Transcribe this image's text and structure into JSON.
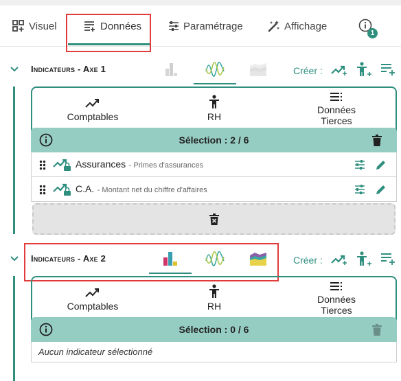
{
  "tabs": [
    {
      "label": "Visuel",
      "icon": "dashboard-add-icon"
    },
    {
      "label": "Données",
      "icon": "list-add-icon",
      "active": true
    },
    {
      "label": "Paramétrage",
      "icon": "sliders-icon"
    },
    {
      "label": "Affichage",
      "icon": "magic-wand-icon"
    }
  ],
  "info_badge": "1",
  "axes": [
    {
      "title_prefix": "Indicateurs - Axe",
      "number": "1",
      "creer_label": "Créer :",
      "categories": [
        "Comptables",
        "RH",
        "Données Tierces"
      ],
      "categories_lines": [
        [
          "Comptables"
        ],
        [
          "RH"
        ],
        [
          "Données",
          "Tierces"
        ]
      ],
      "selection": "Sélection : 2 / 6",
      "rows": [
        {
          "name": "Assurances",
          "sub": "- Primes d'assurances"
        },
        {
          "name": "C.A.",
          "sub": "- Montant net du chiffre d'affaires"
        }
      ]
    },
    {
      "title_prefix": "Indicateurs - Axe",
      "number": "2",
      "creer_label": "Créer :",
      "categories": [
        "Comptables",
        "RH",
        "Données Tierces"
      ],
      "categories_lines": [
        [
          "Comptables"
        ],
        [
          "RH"
        ],
        [
          "Données",
          "Tierces"
        ]
      ],
      "selection": "Sélection : 0 / 6",
      "empty_text": "Aucun indicateur sélectionné"
    }
  ],
  "colors": {
    "accent": "#2f8f7f",
    "selection_bar": "#96cdc3",
    "highlight": "#e23b3b"
  }
}
